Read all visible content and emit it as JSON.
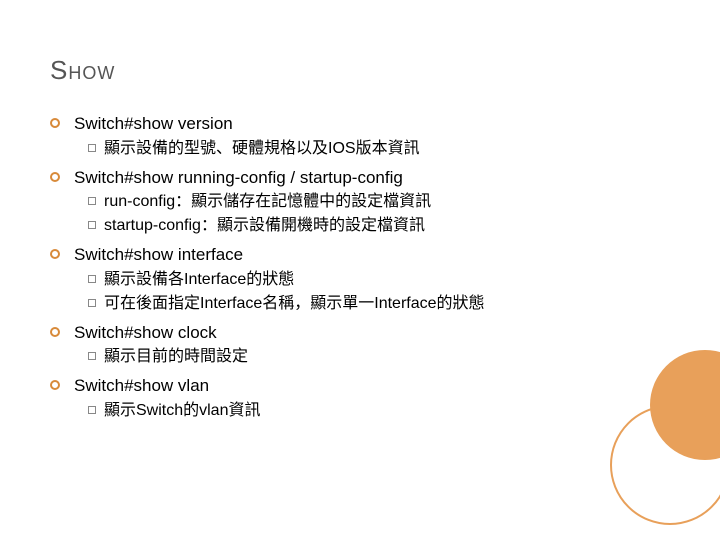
{
  "title": "Show",
  "items": [
    {
      "text": "Switch#show version",
      "subs": [
        "顯示設備的型號、硬體規格以及IOS版本資訊"
      ]
    },
    {
      "text": "Switch#show running-config / startup-config",
      "subs": [
        "run-config：顯示儲存在記憶體中的設定檔資訊",
        "startup-config：顯示設備開機時的設定檔資訊"
      ]
    },
    {
      "text": "Switch#show interface",
      "subs": [
        "顯示設備各Interface的狀態",
        "可在後面指定Interface名稱，顯示單一Interface的狀態"
      ]
    },
    {
      "text": "Switch#show clock",
      "subs": [
        "顯示目前的時間設定"
      ]
    },
    {
      "text": "Switch#show  vlan",
      "subs": [
        "顯示Switch的vlan資訊"
      ]
    }
  ]
}
